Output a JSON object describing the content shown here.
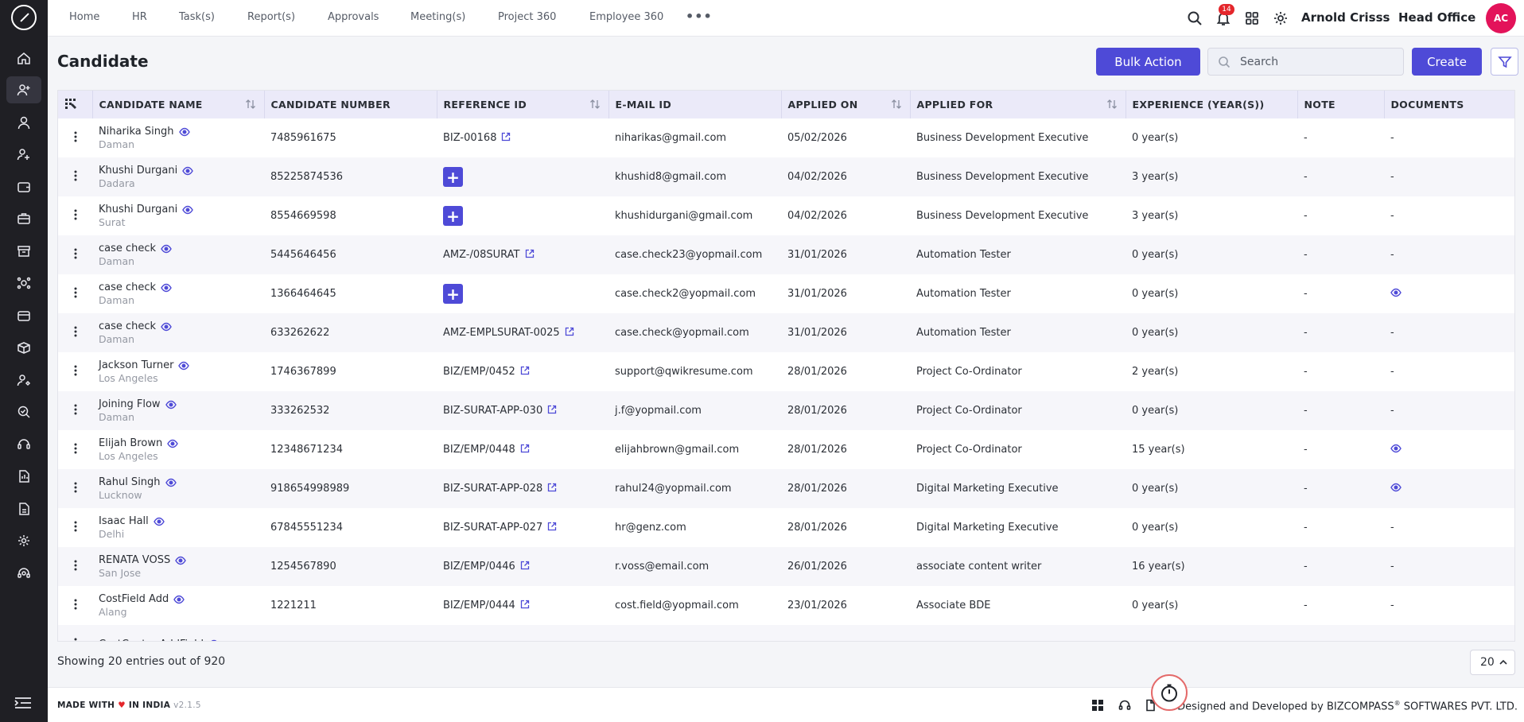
{
  "nav": {
    "tabs": [
      "Home",
      "HR",
      "Task(s)",
      "Report(s)",
      "Approvals",
      "Meeting(s)",
      "Project 360",
      "Employee 360"
    ],
    "more": "•••",
    "notification_count": "14",
    "user_name": "Arnold Crisss",
    "office": "Head Office",
    "avatar_initials": "AC"
  },
  "page": {
    "title": "Candidate",
    "bulk_action_label": "Bulk Action",
    "search_placeholder": "Search",
    "create_label": "Create"
  },
  "table": {
    "columns": [
      "CANDIDATE NAME",
      "CANDIDATE NUMBER",
      "REFERENCE ID",
      "E-MAIL ID",
      "APPLIED ON",
      "APPLIED FOR",
      "EXPERIENCE (YEAR(S))",
      "NOTE",
      "DOCUMENTS"
    ],
    "rows": [
      {
        "name": "Niharika Singh",
        "location": "Daman",
        "number": "7485961675",
        "ref": "BIZ-00168",
        "email": "niharikas@gmail.com",
        "applied_on": "05/02/2026",
        "applied_for": "Business Development Executive",
        "experience": "0 year(s)",
        "note": "-",
        "documents": "-"
      },
      {
        "name": "Khushi Durgani",
        "location": "Dadara",
        "number": "85225874536",
        "ref": "",
        "email": "khushid8@gmail.com",
        "applied_on": "04/02/2026",
        "applied_for": "Business Development Executive",
        "experience": "3 year(s)",
        "note": "-",
        "documents": "-"
      },
      {
        "name": "Khushi Durgani",
        "location": "Surat",
        "number": "8554669598",
        "ref": "",
        "email": "khushidurgani@gmail.com",
        "applied_on": "04/02/2026",
        "applied_for": "Business Development Executive",
        "experience": "3 year(s)",
        "note": "-",
        "documents": "-"
      },
      {
        "name": "case check",
        "location": "Daman",
        "number": "5445646456",
        "ref": "AMZ-/08SURAT",
        "email": "case.check23@yopmail.com",
        "applied_on": "31/01/2026",
        "applied_for": "Automation Tester",
        "experience": "0 year(s)",
        "note": "-",
        "documents": "-"
      },
      {
        "name": "case check",
        "location": "Daman",
        "number": "1366464645",
        "ref": "",
        "email": "case.check2@yopmail.com",
        "applied_on": "31/01/2026",
        "applied_for": "Automation Tester",
        "experience": "0 year(s)",
        "note": "-",
        "documents": "eye"
      },
      {
        "name": "case check",
        "location": "Daman",
        "number": "633262622",
        "ref": "AMZ-EMPLSURAT-0025",
        "email": "case.check@yopmail.com",
        "applied_on": "31/01/2026",
        "applied_for": "Automation Tester",
        "experience": "0 year(s)",
        "note": "-",
        "documents": "-"
      },
      {
        "name": "Jackson Turner",
        "location": "Los Angeles",
        "number": "1746367899",
        "ref": "BIZ/EMP/0452",
        "email": "support@qwikresume.com",
        "applied_on": "28/01/2026",
        "applied_for": "Project Co-Ordinator",
        "experience": "2 year(s)",
        "note": "-",
        "documents": "-"
      },
      {
        "name": "Joining Flow",
        "location": "Daman",
        "number": "333262532",
        "ref": "BIZ-SURAT-APP-030",
        "email": "j.f@yopmail.com",
        "applied_on": "28/01/2026",
        "applied_for": "Project Co-Ordinator",
        "experience": "0 year(s)",
        "note": "-",
        "documents": "-"
      },
      {
        "name": "Elijah Brown",
        "location": "Los Angeles",
        "number": "12348671234",
        "ref": "BIZ/EMP/0448",
        "email": "elijahbrown@gmail.com",
        "applied_on": "28/01/2026",
        "applied_for": "Project Co-Ordinator",
        "experience": "15 year(s)",
        "note": "-",
        "documents": "eye"
      },
      {
        "name": "Rahul Singh",
        "location": "Lucknow",
        "number": "918654998989",
        "ref": "BIZ-SURAT-APP-028",
        "email": "rahul24@yopmail.com",
        "applied_on": "28/01/2026",
        "applied_for": "Digital Marketing Executive",
        "experience": "0 year(s)",
        "note": "-",
        "documents": "eye"
      },
      {
        "name": "Isaac Hall",
        "location": "Delhi",
        "number": "67845551234",
        "ref": "BIZ-SURAT-APP-027",
        "email": "hr@genz.com",
        "applied_on": "28/01/2026",
        "applied_for": "Digital Marketing Executive",
        "experience": "0 year(s)",
        "note": "-",
        "documents": "-"
      },
      {
        "name": "RENATA VOSS",
        "location": "San Jose",
        "number": "1254567890",
        "ref": "BIZ/EMP/0446",
        "email": "r.voss@email.com",
        "applied_on": "26/01/2026",
        "applied_for": "associate content writer",
        "experience": "16 year(s)",
        "note": "-",
        "documents": "-"
      },
      {
        "name": "CostField Add",
        "location": "Alang",
        "number": "1221211",
        "ref": "BIZ/EMP/0444",
        "email": "cost.field@yopmail.com",
        "applied_on": "23/01/2026",
        "applied_for": "Associate BDE",
        "experience": "0 year(s)",
        "note": "-",
        "documents": "-"
      },
      {
        "name": "CostCenter AddField",
        "location": "",
        "number": "",
        "ref": "",
        "email": "",
        "applied_on": "",
        "applied_for": "",
        "experience": "",
        "note": "",
        "documents": ""
      }
    ]
  },
  "pagination": {
    "showing_text": "Showing 20 entries out of 920",
    "page_size": "20"
  },
  "footer": {
    "made_with": "MADE WITH",
    "in_india": "IN INDIA",
    "version": "v2.1.5",
    "designed_by": "Designed and Developed by  BIZCOMPASS",
    "reg": "®",
    "company": " SOFTWARES PVT. LTD."
  },
  "colors": {
    "accent": "#4e4ad7",
    "rail": "#1f1f24",
    "avatar": "#e3135a",
    "badge": "#e4262b"
  }
}
